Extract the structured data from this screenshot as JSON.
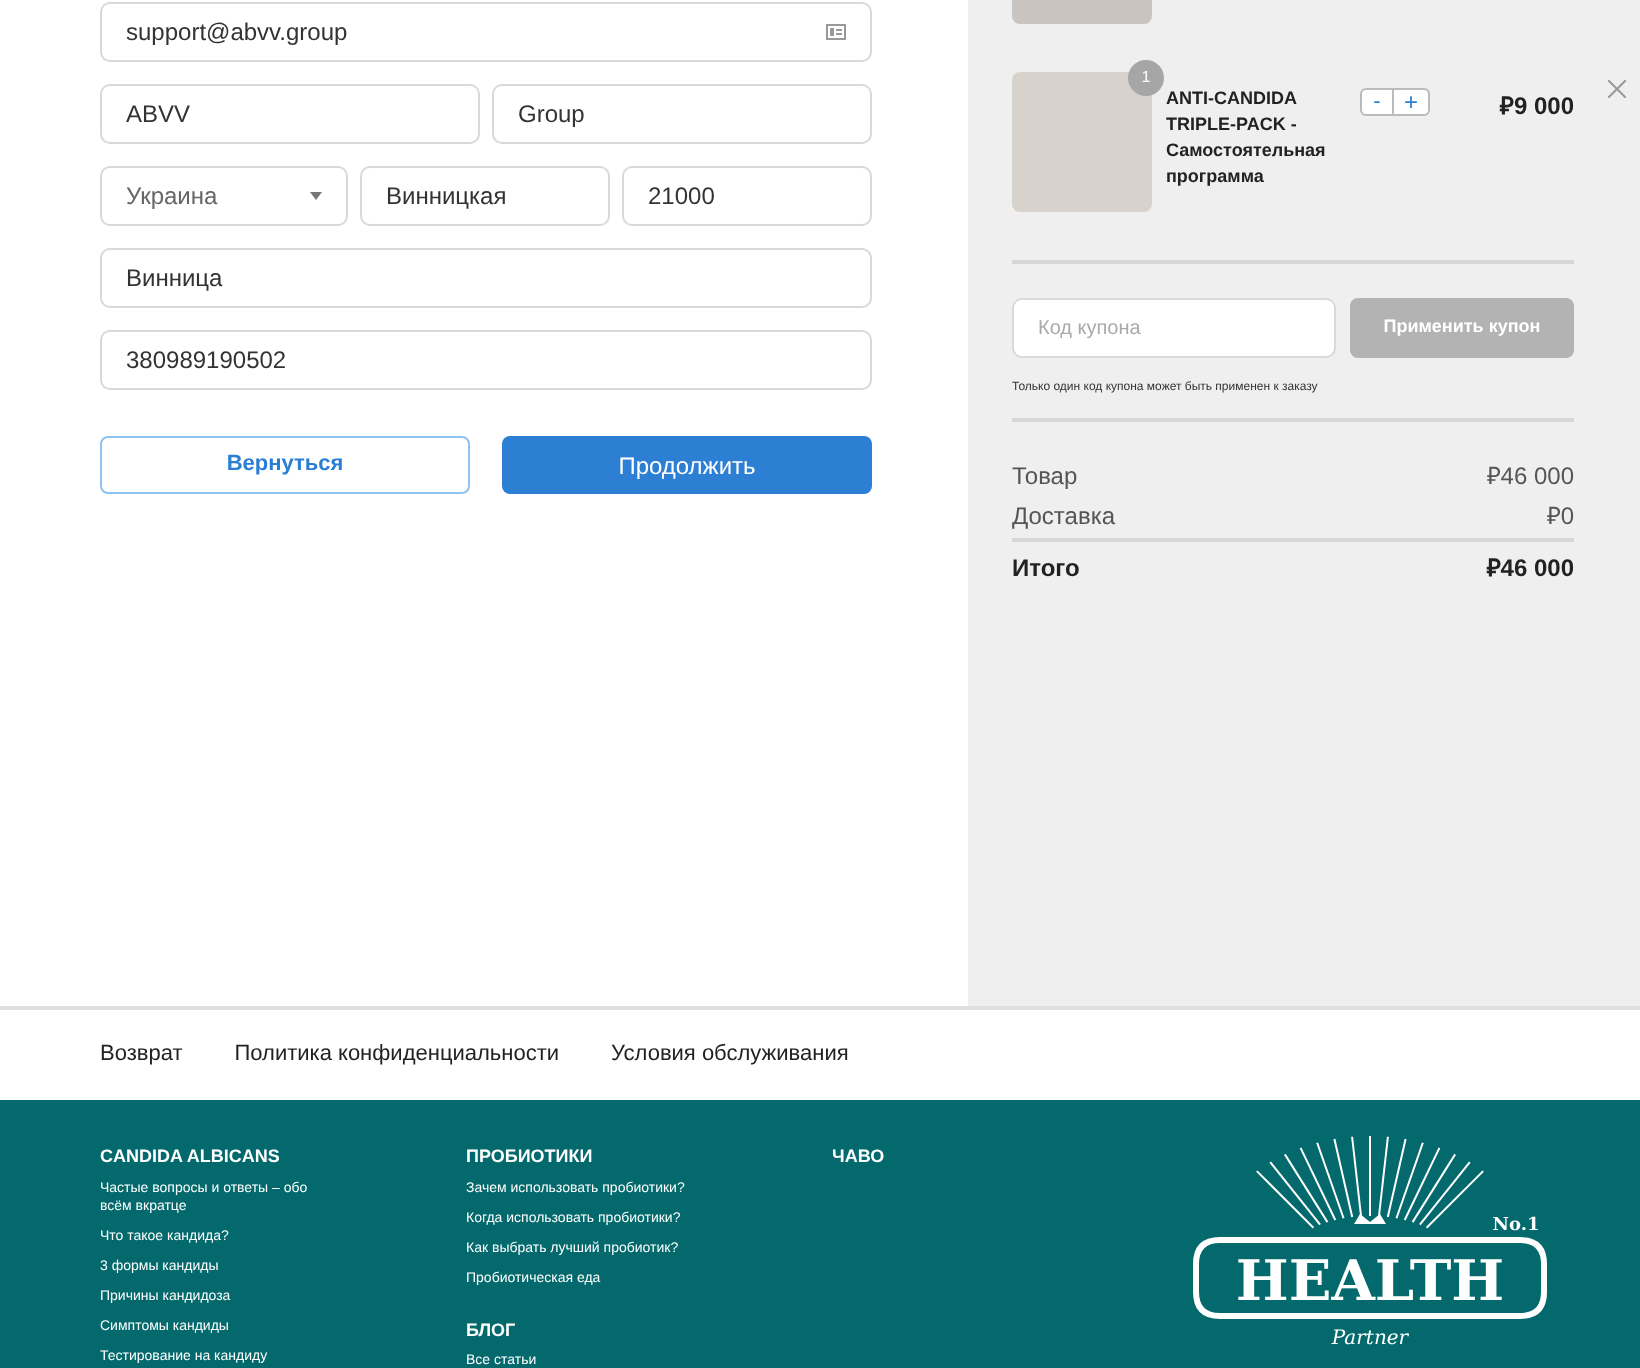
{
  "form": {
    "email": "support@abvv.group",
    "name_row": [
      "ABVV",
      "Group"
    ],
    "country": "Украина",
    "region": "Винницкая",
    "zip": "21000",
    "city": "Винница",
    "phone": "380989190502",
    "back_button": "Вернуться",
    "continue_button": "Продолжить"
  },
  "cart": {
    "items": [
      {
        "badge": "1",
        "title": "ANTI-CANDIDA TRIPLE-PACK - Самостоятельная программа",
        "minus": "-",
        "plus": "+",
        "price": "₽9 000"
      }
    ],
    "coupon": {
      "placeholder": "Код купона",
      "button": "Применить купон",
      "disabled": true,
      "note": "Только один код купона может быть применен к заказу"
    },
    "totals": [
      {
        "label": "Товар",
        "value": "₽46 000",
        "kind": "line"
      },
      {
        "label": "Доставка",
        "value": "₽0",
        "kind": "line"
      },
      {
        "label": "Итого",
        "value": "₽46 000",
        "kind": "total"
      }
    ]
  },
  "footer_links": [
    "Возврат",
    "Политика конфиденциальности",
    "Условия обслуживания"
  ],
  "footer": {
    "columns": [
      {
        "sections": [
          {
            "heading": "CANDIDA ALBICANS",
            "links": [
              "Частые вопросы и ответы – обо всём вкратце",
              "Что такое кандида?",
              "3 формы кандиды",
              "Причины кандидоза",
              "Симптомы кандиды",
              "Тестирование на кандиду"
            ]
          }
        ]
      },
      {
        "sections": [
          {
            "heading": "ПРОБИОТИКИ",
            "links": [
              "Зачем использовать пробиотики?",
              "Когда использовать пробиотики?",
              "Как выбрать лучший пробиотик?",
              "Пробиотическая еда"
            ]
          },
          {
            "heading": "БЛОГ",
            "links": [
              "Все статьи"
            ]
          }
        ]
      },
      {
        "sections": [
          {
            "heading": "ЧАВО"
          }
        ]
      }
    ],
    "logo": {
      "main": "HEALTH",
      "badge": "No.1",
      "sub": "Partner"
    }
  }
}
